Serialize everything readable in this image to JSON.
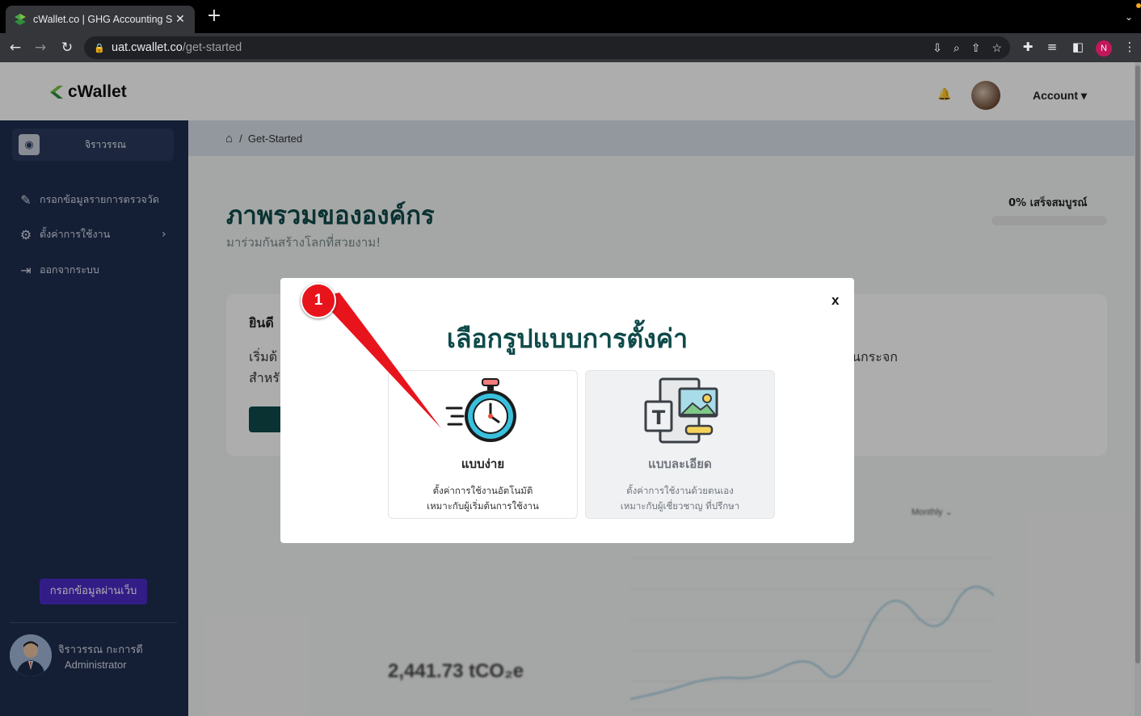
{
  "browser": {
    "tab_title": "cWallet.co | GHG Accounting S",
    "url_host": "uat.cwallet.co",
    "url_path": "/get-started",
    "profile_initial": "N"
  },
  "header": {
    "logo_text": "cWallet",
    "account_label": "Account"
  },
  "sidebar": {
    "org_name": "จิราวรรณ",
    "items": [
      {
        "label": "กรอกข้อมูลรายการตรวจวัด",
        "icon": "pencil-icon"
      },
      {
        "label": "ตั้งค่าการใช้งาน",
        "icon": "gear-icon"
      },
      {
        "label": "ออกจากระบบ",
        "icon": "logout-icon"
      }
    ],
    "web_button": "กรอกข้อมูลผ่านเว็บ",
    "user_name": "จิราวรรณ กะการดี",
    "user_role": "Administrator"
  },
  "breadcrumb": {
    "current": "Get-Started"
  },
  "page": {
    "title": "ภาพรวมขององค์กร",
    "subtitle": "มาร่วมกันสร้างโลกที่สวยงาม!",
    "progress_label": "0% เสร็จสมบูรณ์",
    "progress_value": 0
  },
  "welcome_card": {
    "title": "ยินดี",
    "line1": "เริ่มต้",
    "line2": "สำหรั",
    "line_tail": "นกระจก"
  },
  "dashboard": {
    "stat_value": "2,441.73 tCO₂e",
    "period": "Monthly"
  },
  "modal": {
    "close": "x",
    "title": "เลือกรูปแบบการตั้งค่า",
    "options": [
      {
        "name": "แบบง่าย",
        "desc1": "ตั้งค่าการใช้งานอัตโนมัติ",
        "desc2": "เหมาะกับผู้เริ่มต้นการใช้งาน",
        "icon": "stopwatch-icon"
      },
      {
        "name": "แบบละเอียด",
        "desc1": "ตั้งค่าการใช้งานด้วยตนเอง",
        "desc2": "เหมาะกับผู้เชี่ยวชาญ ที่ปรึกษา",
        "icon": "layout-design-icon"
      }
    ]
  },
  "annotation": {
    "step": "1",
    "color": "#e8141c"
  },
  "colors": {
    "brand": "#0f4a4a",
    "sidebar": "#1e2d4e",
    "button": "#4b2bc7"
  }
}
